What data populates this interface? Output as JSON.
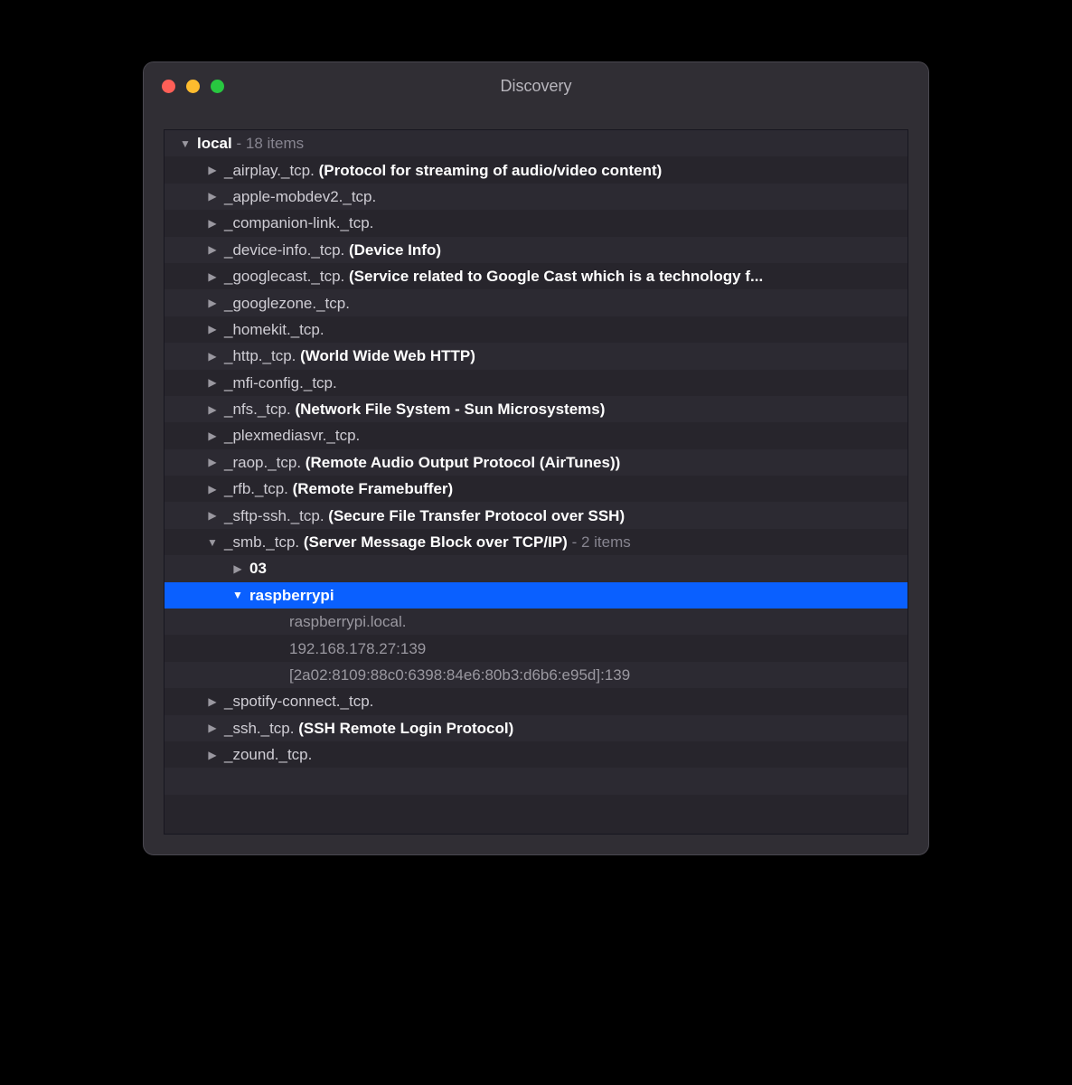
{
  "window": {
    "title": "Discovery"
  },
  "root": {
    "name": "local",
    "count": "18 items"
  },
  "services": [
    {
      "name": "_airplay._tcp.",
      "desc": "(Protocol for streaming of audio/video content)"
    },
    {
      "name": "_apple-mobdev2._tcp.",
      "desc": ""
    },
    {
      "name": "_companion-link._tcp.",
      "desc": ""
    },
    {
      "name": "_device-info._tcp.",
      "desc": "(Device Info)"
    },
    {
      "name": "_googlecast._tcp.",
      "desc": "(Service related to Google Cast which is a technology f..."
    },
    {
      "name": "_googlezone._tcp.",
      "desc": ""
    },
    {
      "name": "_homekit._tcp.",
      "desc": ""
    },
    {
      "name": "_http._tcp.",
      "desc": "(World Wide Web HTTP)"
    },
    {
      "name": "_mfi-config._tcp.",
      "desc": ""
    },
    {
      "name": "_nfs._tcp.",
      "desc": "(Network File System - Sun Microsystems)"
    },
    {
      "name": "_plexmediasvr._tcp.",
      "desc": ""
    },
    {
      "name": "_raop._tcp.",
      "desc": "(Remote Audio Output Protocol (AirTunes))"
    },
    {
      "name": "_rfb._tcp.",
      "desc": "(Remote Framebuffer)"
    },
    {
      "name": "_sftp-ssh._tcp.",
      "desc": "(Secure File Transfer Protocol over SSH)"
    }
  ],
  "smb": {
    "name": "_smb._tcp.",
    "desc": "(Server Message Block over TCP/IP)",
    "count": "2 items",
    "children": [
      {
        "name": "03"
      },
      {
        "name": "raspberrypi"
      }
    ],
    "details": [
      "raspberrypi.local.",
      "192.168.178.27:139",
      "[2a02:8109:88c0:6398:84e6:80b3:d6b6:e95d]:139"
    ]
  },
  "servicesAfter": [
    {
      "name": "_spotify-connect._tcp.",
      "desc": ""
    },
    {
      "name": "_ssh._tcp.",
      "desc": "(SSH Remote Login Protocol)"
    },
    {
      "name": "_zound._tcp.",
      "desc": ""
    }
  ]
}
